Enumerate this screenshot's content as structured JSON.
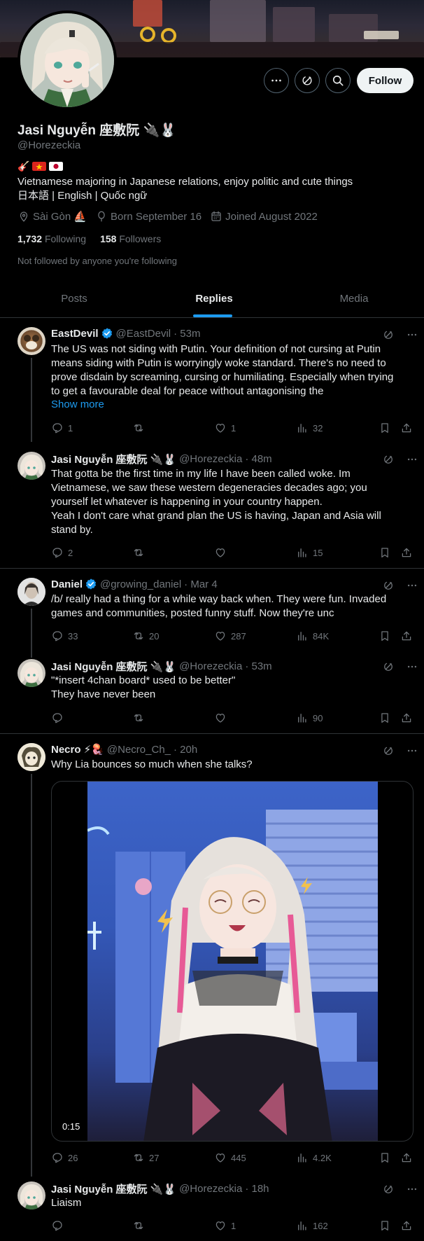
{
  "profile": {
    "name": "Jasi Nguyễn 座敷阮 🔌🐰",
    "handle": "@Horezeckia",
    "bio": "Vietnamese majoring in Japanese relations, enjoy politic and cute things\n日本語 | English | Quốc ngữ",
    "location": "Sài Gòn ⛵",
    "born": "Born September 16",
    "joined": "Joined August 2022",
    "following_count": "1,732",
    "following_label": "Following",
    "followers_count": "158",
    "followers_label": "Followers",
    "not_followed": "Not followed by anyone you're following"
  },
  "header_actions": {
    "follow_label": "Follow",
    "more_icon": "more-icon",
    "grok_icon": "grok-icon",
    "search_icon": "search-icon"
  },
  "tabs": [
    {
      "label": "Posts",
      "active": false
    },
    {
      "label": "Replies",
      "active": true
    },
    {
      "label": "Media",
      "active": false
    }
  ],
  "posts": [
    {
      "name": "EastDevil",
      "verified": true,
      "handle": "@EastDevil",
      "time": "· 53m",
      "text": "The US was not siding with Putin. Your definition of not cursing at Putin\nmeans siding with Putin is worryingly woke standard. There's no need to\nprove disdain by screaming, cursing or humiliating. Especially when trying\nto get a favourable deal for peace without antagonising the",
      "show_more": "Show more",
      "replies": "1",
      "reposts": "",
      "likes": "1",
      "views": "32"
    },
    {
      "name": "Jasi Nguyễn 座敷阮 🔌🐰",
      "verified": false,
      "handle": "@Horezeckia",
      "time": "· 48m",
      "text": "That gotta be the first time in my life I have been called woke. Im\nVietnamese, we saw these western degeneracies decades ago; you\nyourself let whatever is happening in your country happen.\nYeah I don't care what grand plan the US is having, Japan and Asia will\nstand by.",
      "replies": "2",
      "reposts": "",
      "likes": "",
      "views": "15"
    },
    {
      "name": "Daniel",
      "verified": true,
      "handle": "@growing_daniel",
      "time": "· Mar 4",
      "text": "/b/ really had a thing for a while way back when. They were fun. Invaded\ngames and communities, posted funny stuff. Now they're unc",
      "replies": "33",
      "reposts": "20",
      "likes": "287",
      "views": "84K"
    },
    {
      "name": "Jasi Nguyễn 座敷阮 🔌🐰",
      "verified": false,
      "handle": "@Horezeckia",
      "time": "· 53m",
      "text": "\"*insert 4chan board* used to be better\"\nThey have never been",
      "replies": "",
      "reposts": "",
      "likes": "",
      "views": "90"
    },
    {
      "name": "Necro ⚡🪼",
      "verified": false,
      "handle": "@Necro_Ch_",
      "time": "· 20h",
      "text": "Why Lia bounces so much when she talks?",
      "video_time": "0:15",
      "replies": "26",
      "reposts": "27",
      "likes": "445",
      "views": "4.2K"
    },
    {
      "name": "Jasi Nguyễn 座敷阮 🔌🐰",
      "verified": false,
      "handle": "@Horezeckia",
      "time": "· 18h",
      "text": "Liaism",
      "replies": "",
      "reposts": "",
      "likes": "1",
      "views": "162"
    }
  ],
  "colors": {
    "background": "#000000",
    "text": "#e7e9ea",
    "muted": "#71767b",
    "accent": "#1d9bf0",
    "divider": "#2f3336"
  }
}
